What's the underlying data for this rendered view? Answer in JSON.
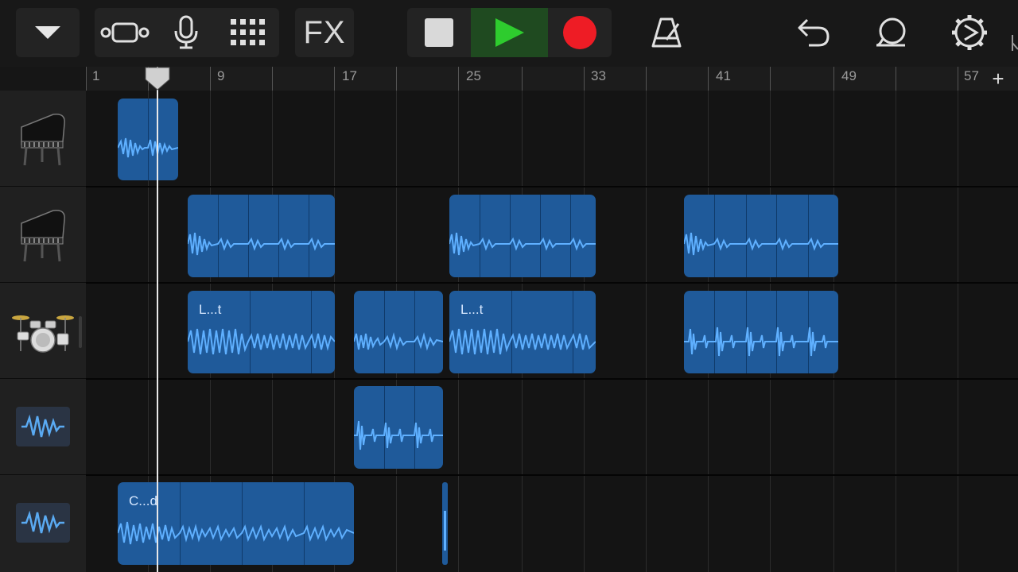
{
  "toolbar": {
    "dropdown_icon": "chevron-down-icon",
    "view_icon": "tracks-view-icon",
    "mic_icon": "microphone-icon",
    "grid_icon": "grid-icon",
    "fx_label": "FX",
    "stop_icon": "stop-icon",
    "play_icon": "play-icon",
    "record_icon": "record-icon",
    "metronome_icon": "metronome-icon",
    "undo_icon": "undo-icon",
    "loop_icon": "loop-browser-icon",
    "settings_icon": "settings-icon",
    "colors": {
      "play_active": "#2ecc2e",
      "record": "#ee1c25",
      "region": "#1f5a9a"
    }
  },
  "ruler": {
    "markers": [
      "1",
      "9",
      "17",
      "25",
      "33",
      "41",
      "49",
      "57"
    ],
    "add_label": "+"
  },
  "tracks": [
    {
      "instrument": "grand-piano-icon"
    },
    {
      "instrument": "grand-piano-icon"
    },
    {
      "instrument": "drum-kit-icon"
    },
    {
      "instrument": "audio-waveform-icon"
    },
    {
      "instrument": "audio-waveform-icon"
    }
  ],
  "region_labels": {
    "drums_1": "L...t",
    "drums_3": "L...t",
    "audio_2": "C...d"
  }
}
